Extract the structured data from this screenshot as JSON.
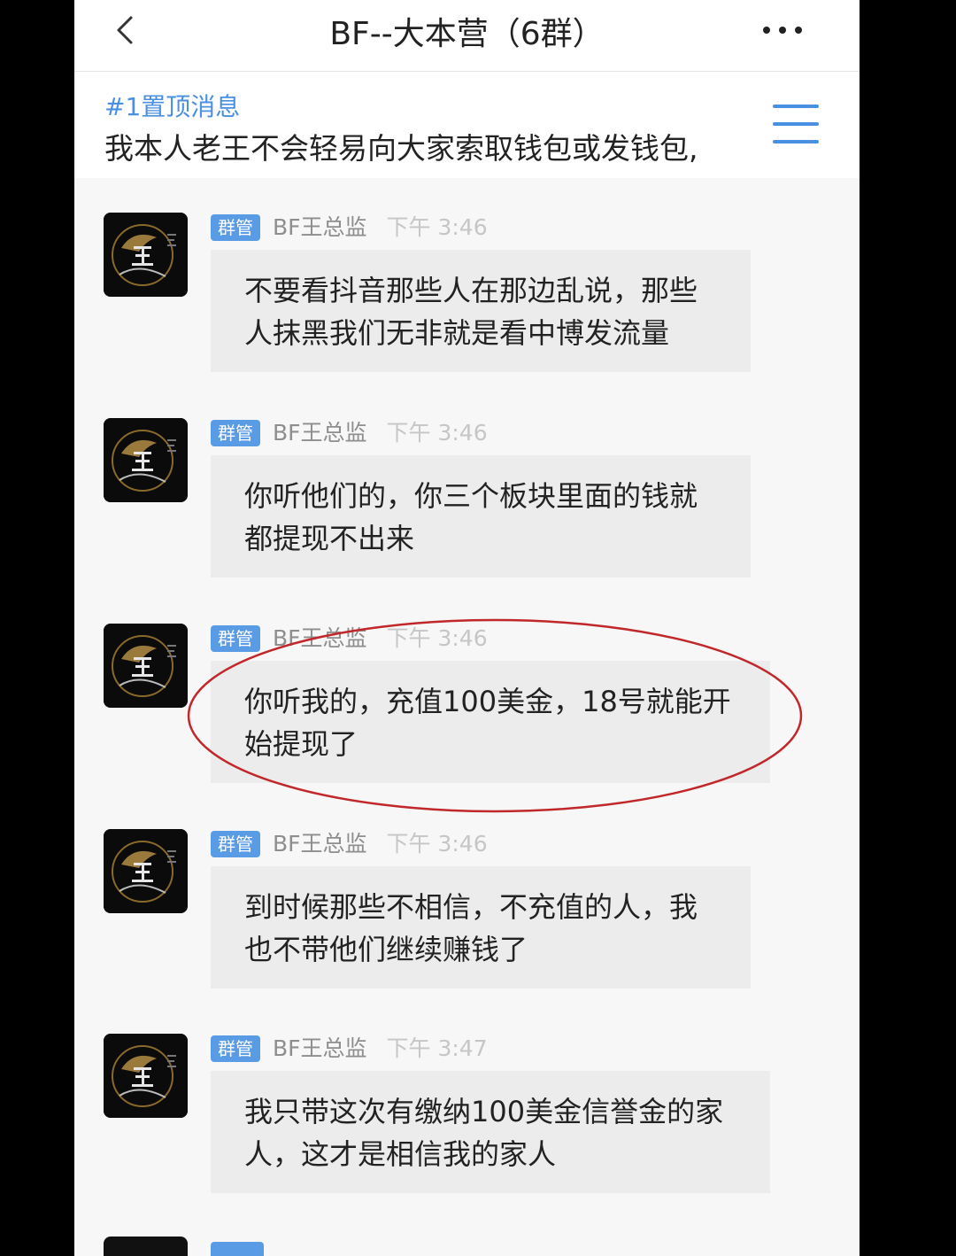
{
  "header": {
    "title": "BF--大本营（6群）",
    "back_icon": "chevron-left-icon",
    "more_icon": "ellipsis-icon"
  },
  "pinned": {
    "label": "#1置顶消息",
    "text": "我本人老王不会轻易向大家索取钱包或发钱包,",
    "menu_icon": "list-menu-icon"
  },
  "colors": {
    "accent": "#4a90e2",
    "badge": "#5a9be6",
    "bubble": "#ececec",
    "annotation_circle": "#c0282b"
  },
  "messages": [
    {
      "badge": "群管",
      "sender": "BF王总监",
      "time": "下午 3:46",
      "lines": [
        "不要看抖音那些人在那边乱说，那些",
        "人抹黑我们无非就是看中博发流量"
      ]
    },
    {
      "badge": "群管",
      "sender": "BF王总监",
      "time": "下午 3:46",
      "lines": [
        "你听他们的，你三个板块里面的钱就",
        "都提现不出来"
      ]
    },
    {
      "badge": "群管",
      "sender": "BF王总监",
      "time": "下午 3:46",
      "lines": [
        "你听我的，充值100美金，18号就能开",
        "始提现了"
      ]
    },
    {
      "badge": "群管",
      "sender": "BF王总监",
      "time": "下午 3:46",
      "lines": [
        "到时候那些不相信，不充值的人，我",
        "也不带他们继续赚钱了"
      ]
    },
    {
      "badge": "群管",
      "sender": "BF王总监",
      "time": "下午 3:47",
      "lines": [
        "我只带这次有缴纳100美金信誉金的家",
        "人，这才是相信我的家人"
      ]
    }
  ]
}
